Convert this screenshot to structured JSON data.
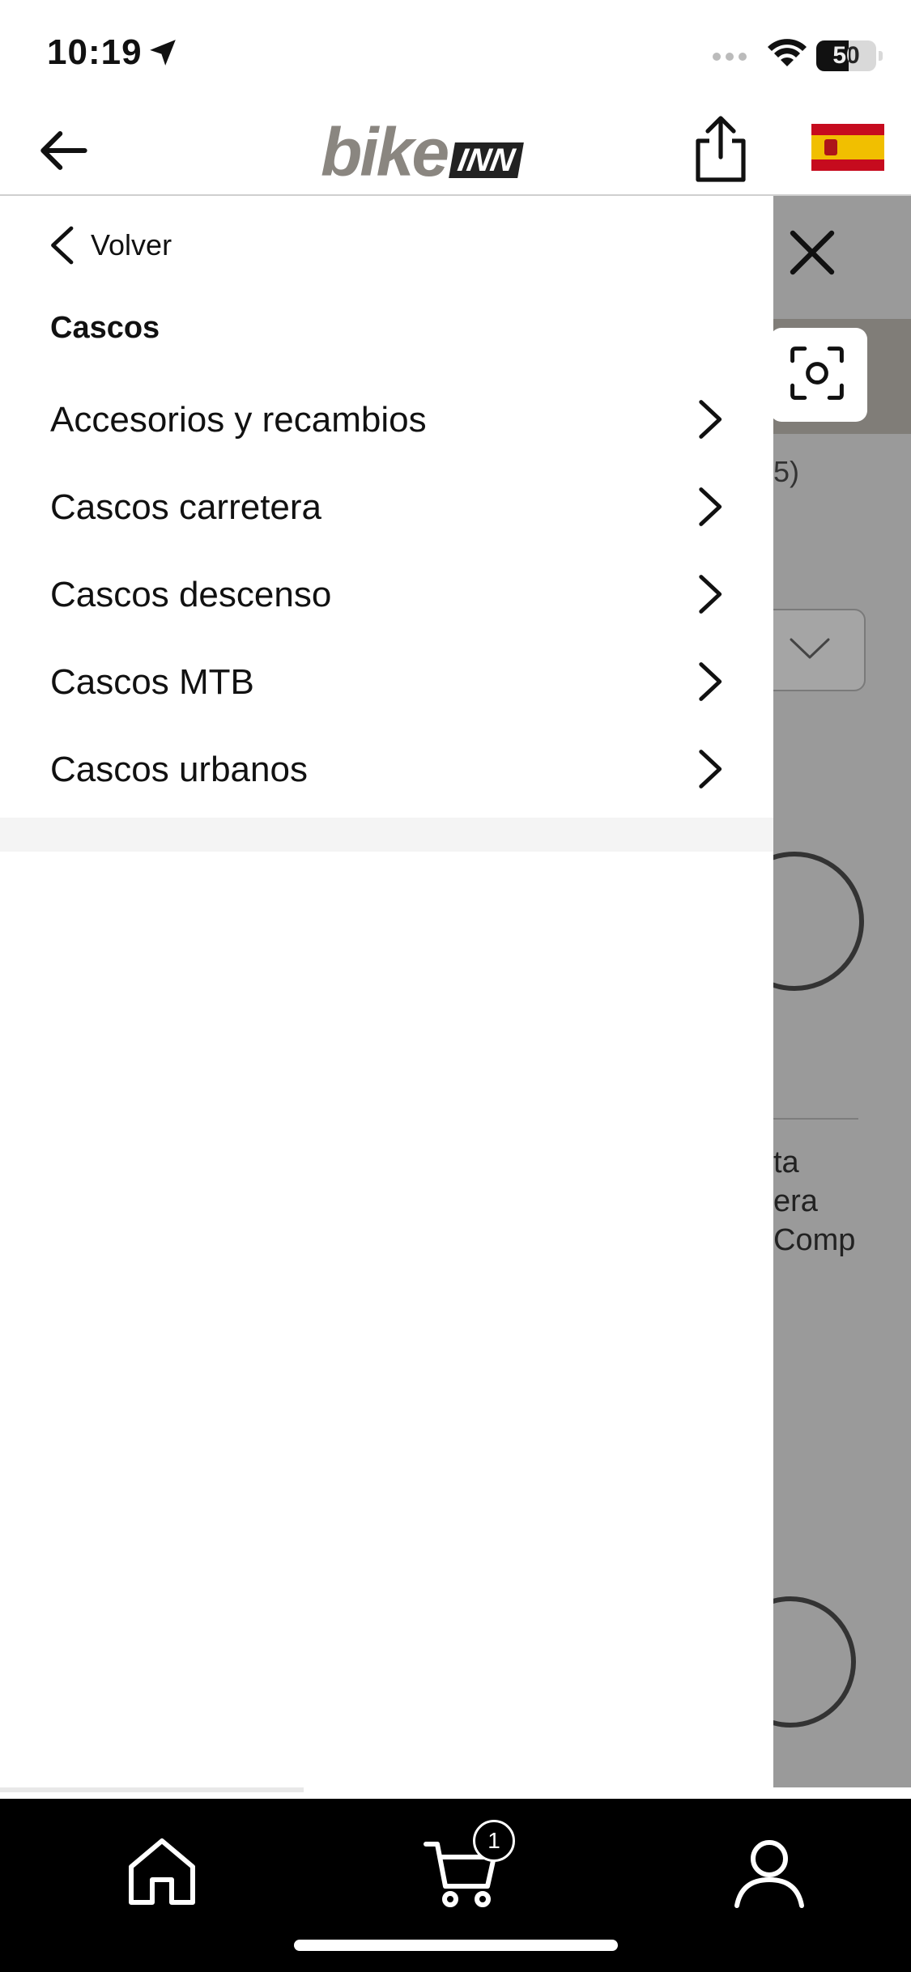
{
  "status_bar": {
    "time": "10:19",
    "battery": "50"
  },
  "header": {
    "logo_main": "bike",
    "logo_badge": "INN"
  },
  "drawer": {
    "back_label": "Volver",
    "section_title": "Cascos",
    "items": [
      {
        "label": "Accesorios y recambios"
      },
      {
        "label": "Cascos carretera"
      },
      {
        "label": "Cascos descenso"
      },
      {
        "label": "Cascos MTB"
      },
      {
        "label": "Cascos urbanos"
      }
    ]
  },
  "background_page": {
    "result_count_fragment": "5)",
    "product_title_fragment": "ta\nera\nComp"
  },
  "tabbar": {
    "cart_badge": "1"
  },
  "colors": {
    "logo_gray": "#8a8680",
    "flag_red": "#c60b1e",
    "flag_yellow": "#f1bf00",
    "overlay": "#9a9a9a"
  }
}
